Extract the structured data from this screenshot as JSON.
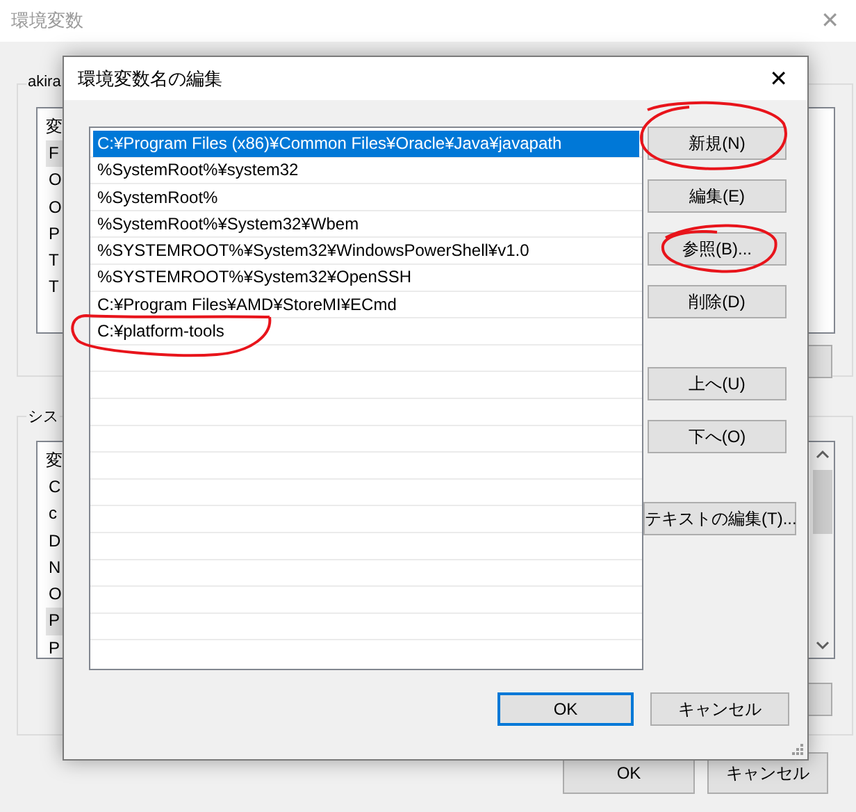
{
  "background_window": {
    "title": "環境変数",
    "close": "✕",
    "user_group": {
      "label": "akira",
      "header": "変",
      "rows": [
        {
          "text": "F",
          "selected": true
        },
        {
          "text": "O",
          "selected": false
        },
        {
          "text": "O",
          "selected": false
        },
        {
          "text": "P",
          "selected": false
        },
        {
          "text": "T",
          "selected": false
        },
        {
          "text": "T",
          "selected": false
        }
      ]
    },
    "system_group": {
      "label": "シス",
      "header": "変",
      "rows": [
        {
          "text": "C",
          "selected": false
        },
        {
          "text": "c",
          "selected": false
        },
        {
          "text": "D",
          "selected": false
        },
        {
          "text": "N",
          "selected": false
        },
        {
          "text": "O",
          "selected": false
        },
        {
          "text": "P",
          "selected": true
        },
        {
          "text": "P",
          "selected": false
        }
      ]
    },
    "buttons": [
      "OK",
      "キャンセル"
    ]
  },
  "dialog": {
    "title": "環境変数名の編集",
    "close": "✕",
    "paths": [
      {
        "text": "C:¥Program Files (x86)¥Common Files¥Oracle¥Java¥javapath",
        "selected": true
      },
      {
        "text": "%SystemRoot%¥system32",
        "selected": false
      },
      {
        "text": "%SystemRoot%",
        "selected": false
      },
      {
        "text": "%SystemRoot%¥System32¥Wbem",
        "selected": false
      },
      {
        "text": "%SYSTEMROOT%¥System32¥WindowsPowerShell¥v1.0",
        "selected": false
      },
      {
        "text": "%SYSTEMROOT%¥System32¥OpenSSH",
        "selected": false
      },
      {
        "text": "C:¥Program Files¥AMD¥StoreMI¥ECmd",
        "selected": false
      },
      {
        "text": "C:¥platform-tools",
        "selected": false
      }
    ],
    "side_buttons": [
      "新規(N)",
      "編集(E)",
      "参照(B)...",
      "削除(D)",
      "上へ(U)",
      "下へ(O)",
      "テキストの編集(T)..."
    ],
    "ok": "OK",
    "cancel": "キャンセル"
  }
}
